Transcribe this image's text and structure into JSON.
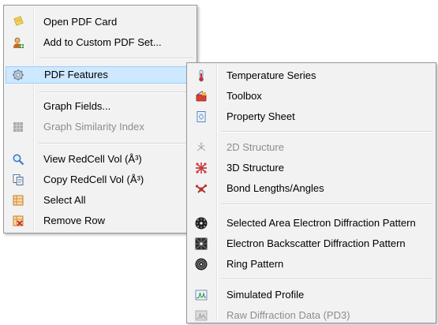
{
  "main_menu": {
    "open_pdf_card": "Open PDF Card",
    "add_custom_set": "Add to Custom PDF Set...",
    "pdf_features": "PDF Features",
    "graph_fields": "Graph Fields...",
    "graph_similarity": "Graph Similarity Index",
    "view_redcell": "View RedCell Vol (Å³)",
    "copy_redcell": "Copy RedCell Vol (Å³)",
    "select_all": "Select All",
    "remove_row": "Remove Row"
  },
  "submenu": {
    "temperature_series": "Temperature Series",
    "toolbox": "Toolbox",
    "property_sheet": "Property Sheet",
    "structure_2d": "2D Structure",
    "structure_3d": "3D Structure",
    "bond_lengths": "Bond Lengths/Angles",
    "saed_pattern": "Selected Area Electron Diffraction Pattern",
    "ebsd_pattern": "Electron Backscatter Diffraction Pattern",
    "ring_pattern": "Ring Pattern",
    "simulated_profile": "Simulated Profile",
    "raw_diffraction": "Raw Diffraction Data (PD3)"
  },
  "colors": {
    "menu_bg": "#f2f2f2",
    "highlight_bg": "#cde8ff",
    "disabled_text": "#8d8d8d"
  }
}
